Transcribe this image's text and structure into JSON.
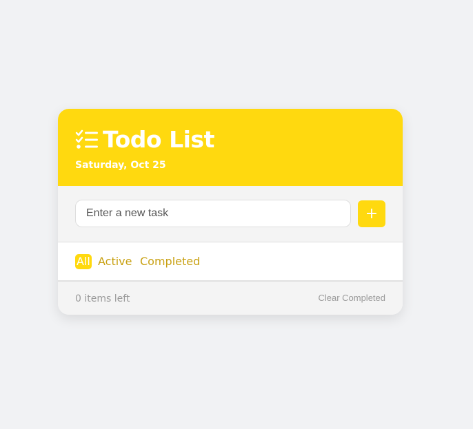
{
  "header": {
    "icon": "checklist-icon",
    "title": "Todo List",
    "date": "Saturday, Oct 25"
  },
  "new_task": {
    "placeholder": "Enter a new task",
    "value": "",
    "add_label": "+"
  },
  "filters": [
    {
      "label": "All",
      "active": true
    },
    {
      "label": "Active",
      "active": false
    },
    {
      "label": "Completed",
      "active": false
    }
  ],
  "footer": {
    "items_left": "0 items left",
    "clear_label": "Clear Completed"
  },
  "colors": {
    "accent": "#ffd90f",
    "filter_text": "#c8a011",
    "background": "#f1f2f4"
  }
}
